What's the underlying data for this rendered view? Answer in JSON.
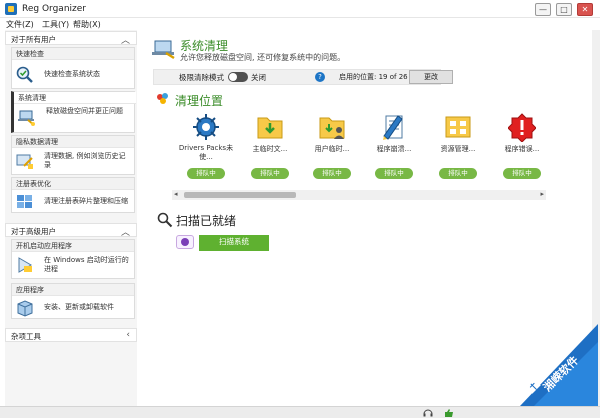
{
  "window": {
    "title": "Reg Organizer",
    "buttons": [
      "—",
      "□",
      "✕"
    ]
  },
  "menu": [
    "文件(Z)",
    "工具(Y)",
    "帮助(X)"
  ],
  "sidebar": {
    "section_all": "对于所有用户",
    "groups_all": [
      {
        "title": "快速检查",
        "text": "快速检查系统状态",
        "icon": "magnifier-check-icon"
      },
      {
        "title": "系统清理",
        "text": "释放磁盘空间并更正问题",
        "icon": "laptop-clean-icon"
      },
      {
        "title": "隐私数据清理",
        "text": "清理数据, 例如浏览历史记录",
        "icon": "privacy-icon"
      },
      {
        "title": "注册表优化",
        "text": "清理注册表碎片整理和压缩",
        "icon": "registry-icon"
      }
    ],
    "section_adv": "对于高级用户",
    "groups_adv": [
      {
        "title": "开机启动应用程序",
        "text": "在 Windows 启动时运行的进程",
        "icon": "startup-icon"
      },
      {
        "title": "应用程序",
        "text": "安装、更新或卸载软件",
        "icon": "box-icon"
      }
    ],
    "section_misc": "杂项工具"
  },
  "main": {
    "title": "系统清理",
    "subtitle": "允许您释放磁盘空间, 还可修复系统中的问题。",
    "options": {
      "mode_label": "极限清除模式",
      "mode_state": "关闭",
      "enabled_label": "启用的位置: 19 of 26",
      "change_button": "更改"
    },
    "locations_title": "清理位置",
    "locations": [
      {
        "label": "Drivers Packs未使...",
        "status": "排队中",
        "icon": "drivers-gear-icon"
      },
      {
        "label": "主临时文...",
        "status": "排队中",
        "icon": "folder-download-icon"
      },
      {
        "label": "用户临时...",
        "status": "排队中",
        "icon": "folder-user-icon"
      },
      {
        "label": "程序崩溃...",
        "status": "排队中",
        "icon": "pencil-document-icon"
      },
      {
        "label": "资源管理...",
        "status": "排队中",
        "icon": "explorer-grid-icon"
      },
      {
        "label": "程序错误...",
        "status": "排队中",
        "icon": "error-badge-icon"
      }
    ],
    "scan_title": "扫描已就绪",
    "scan_button": "扫描系统"
  },
  "watermark": "湘嵘软件"
}
